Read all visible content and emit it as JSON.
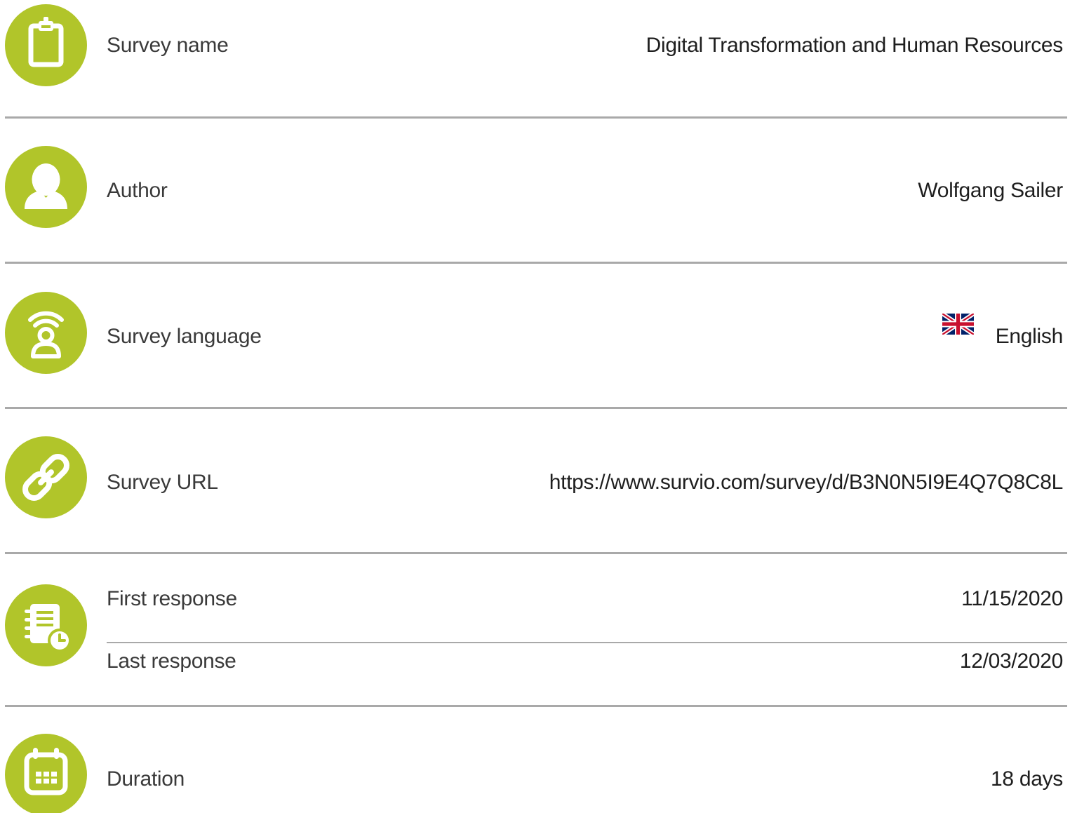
{
  "colors": {
    "accent": "#b1c52a",
    "divider": "#a9a9a9"
  },
  "rows": {
    "survey_name": {
      "label": "Survey name",
      "value": "Digital Transformation and Human Resources",
      "icon": "clipboard-icon"
    },
    "author": {
      "label": "Author",
      "value": "Wolfgang Sailer",
      "icon": "user-icon"
    },
    "language": {
      "label": "Survey language",
      "value": "English",
      "icon": "broadcast-person-icon",
      "flag": "uk-flag-icon"
    },
    "url": {
      "label": "Survey URL",
      "value": "https://www.survio.com/survey/d/B3N0N5I9E4Q7Q8C8L",
      "icon": "link-icon"
    },
    "responses": {
      "icon": "document-clock-icon",
      "first_label": "First response",
      "first_value": "11/15/2020",
      "last_label": "Last response",
      "last_value": "12/03/2020"
    },
    "duration": {
      "label": "Duration",
      "value": "18 days",
      "icon": "calendar-icon"
    }
  }
}
